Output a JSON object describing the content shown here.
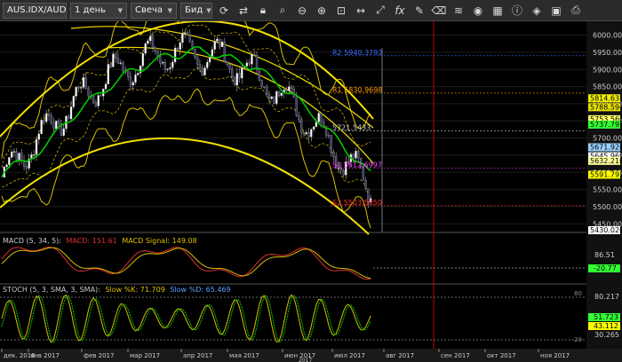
{
  "toolbar": {
    "symbol": "AUS.IDX/AUD",
    "timeframe": "1 день",
    "chart_type": "Свеча",
    "price_type": "Бид",
    "icons": [
      "refresh-icon",
      "sync-icon",
      "lock-icon",
      "zoom-area-icon",
      "zoom-out-icon",
      "zoom-in-icon",
      "fit-icon",
      "stretch-icon",
      "resize-icon",
      "fx-icon",
      "pen-icon",
      "eraser-icon",
      "layers-icon",
      "eye-icon",
      "template-icon",
      "info-icon",
      "paint-icon",
      "save-icon",
      "screenshot-icon"
    ]
  },
  "colors": {
    "price_bg": "#000000",
    "candle_up": "#ffffff",
    "candle_down": "#3a3a6a",
    "ma": "#00c800",
    "bands": "#d8c000",
    "arc": "#f2e000",
    "vline": "#c00000"
  },
  "price_axis": [
    "6000.00",
    "5950.00",
    "5900.00",
    "5850.00",
    "5800.00",
    "5750.00",
    "5700.00",
    "5650.00",
    "5600.00",
    "5550.00",
    "5500.00",
    "5450.00"
  ],
  "price_labels": [
    {
      "text": "5814.637",
      "value": 5814.6,
      "bg": "#f4f000",
      "fg": "#000"
    },
    {
      "text": "5788.594",
      "value": 5788.6,
      "bg": "#e8e000",
      "fg": "#000"
    },
    {
      "text": "5753.560",
      "value": 5753.6,
      "bg": "#ffff66",
      "fg": "#000"
    },
    {
      "text": "5737.795",
      "value": 5737.8,
      "bg": "#33ff33",
      "fg": "#000"
    },
    {
      "text": "5671.926",
      "value": 5671.9,
      "bg": "#9ad0ff",
      "fg": "#000"
    },
    {
      "text": "5645.969",
      "value": 5645.9,
      "bg": "#ffffff",
      "fg": "#000"
    },
    {
      "text": "5632.210",
      "value": 5632.2,
      "bg": "#ffff99",
      "fg": "#000"
    },
    {
      "text": "5591.793",
      "value": 5591.8,
      "bg": "#ffff00",
      "fg": "#000"
    },
    {
      "text": "5430.026",
      "value": 5430.0,
      "bg": "#ffffff",
      "fg": "#000"
    }
  ],
  "fib_labels": [
    {
      "text": "R2 5940.3792",
      "value": 5940,
      "color": "#3a6cff"
    },
    {
      "text": "R1 5830.9698",
      "value": 5831,
      "color": "#ff9a00"
    },
    {
      "text": "5721.5433",
      "value": 5721,
      "color": "#cccccc"
    },
    {
      "text": "S1 5612.6997",
      "value": 5612,
      "color": "#ff44ff"
    },
    {
      "text": "S2 5503.5650",
      "value": 5503,
      "color": "#ff3030"
    }
  ],
  "macd": {
    "label_name": "MACD (5, 34, 5):",
    "label_macd": "MACD: 151.61",
    "label_signal": "MACD Signal: 149.08",
    "axis": [
      "86.51",
      "-20.77"
    ],
    "current": "-20.77"
  },
  "stoch": {
    "label_name": "STOCH (5, 3, SMA, 3, SMA):",
    "label_k": "Slow %K: 71.709",
    "label_d": "Slow %D: 65.469",
    "axis": [
      "80.217",
      "51.723",
      "43.112",
      "30.265"
    ],
    "levels": [
      "80",
      "20"
    ]
  },
  "time_axis": {
    "labels": [
      "дек. 2016",
      "янв 2017",
      "фев 2017",
      "мар 2017",
      "апр 2017",
      "мая 2017",
      "июн 2017",
      "июл 2017",
      "авг 2017",
      "сен 2017",
      "окт 2017",
      "ноя 2017"
    ],
    "footer": "2017"
  },
  "chart_data": {
    "type": "line",
    "price_range": [
      5430,
      6030
    ],
    "x": [
      "янв 2017",
      "фев 2017",
      "мар 2017",
      "апр 2017",
      "мая 2017",
      "июн 2017",
      "июл 2017"
    ],
    "last_price": 5671.926
  }
}
